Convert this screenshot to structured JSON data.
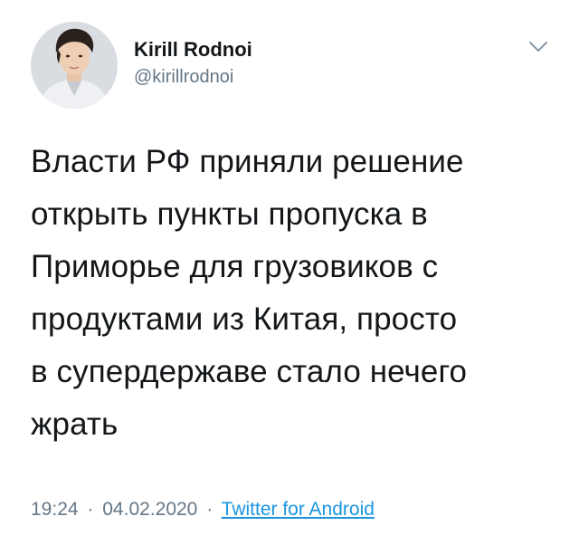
{
  "author": {
    "name": "Kirill Rodnoi",
    "handle": "@kirillrodnoi"
  },
  "icons": {
    "menu": "chevron-down-icon",
    "avatar": "avatar"
  },
  "tweet": {
    "lines": [
      "Власти РФ приняли решение",
      "открыть пункты пропуска в",
      "Приморье для грузовиков с",
      "продуктами из Китая, просто",
      "в супердержаве стало нечего",
      "жрать"
    ]
  },
  "meta": {
    "time": "19:24",
    "separator": "·",
    "date": "04.02.2020",
    "source": "Twitter for Android"
  },
  "colors": {
    "text": "#14171a",
    "secondary": "#657786",
    "link": "#1b95e0"
  }
}
